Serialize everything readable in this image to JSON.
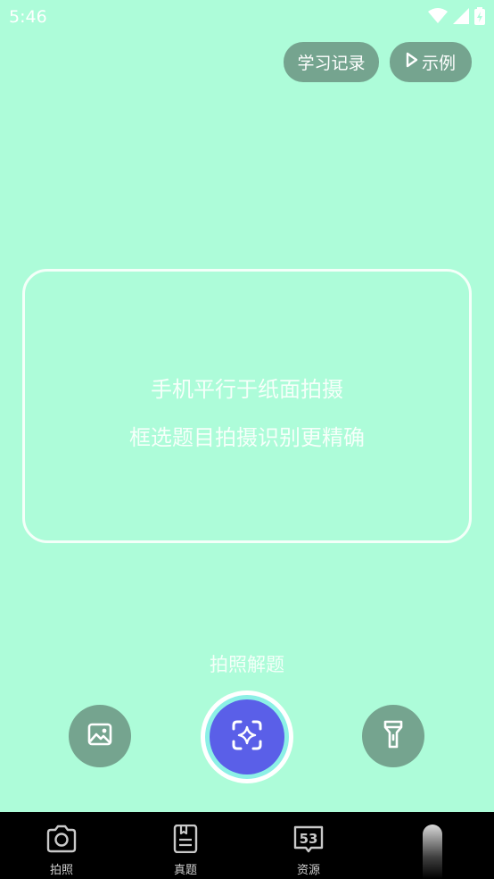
{
  "status_bar": {
    "time": "5:46",
    "icons": [
      "wifi-icon",
      "signal-icon",
      "battery-charging-icon"
    ]
  },
  "top_actions": {
    "history_label": "学习记录",
    "example_label": "示例",
    "example_icon": "play-icon"
  },
  "scan_frame": {
    "hint_line_1": "手机平行于纸面拍摄",
    "hint_line_2": "框选题目拍摄识别更精确"
  },
  "capture": {
    "action_label": "拍照解题",
    "gallery_icon": "image-icon",
    "shutter_icon": "ai-scan-icon",
    "flash_icon": "flashlight-icon"
  },
  "bottom_nav": {
    "items": [
      {
        "label": "拍照",
        "icon": "camera-icon"
      },
      {
        "label": "真题",
        "icon": "document-icon"
      },
      {
        "label": "资源",
        "icon": "book-53-icon",
        "badge": "53"
      }
    ]
  },
  "colors": {
    "background": "#adfcd9",
    "pill": "#75a48f",
    "shutter": "#5a5fe8",
    "nav_background": "#000000"
  }
}
